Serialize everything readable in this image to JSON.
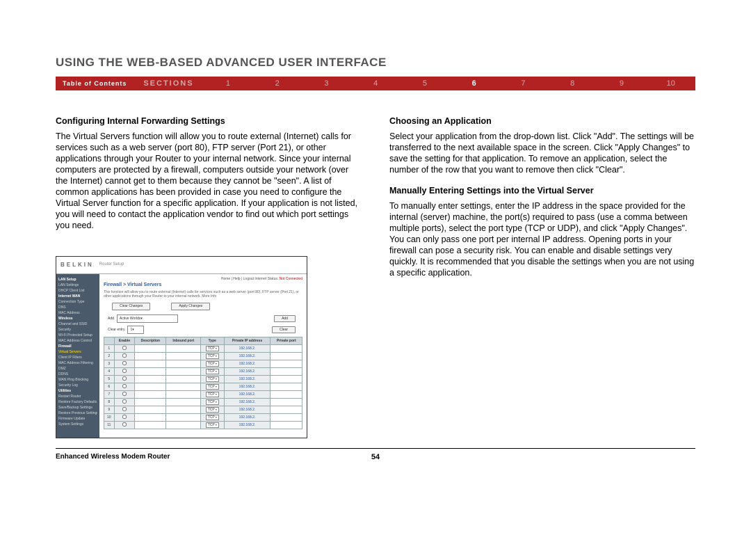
{
  "title": "USING THE WEB-BASED ADVANCED USER INTERFACE",
  "nav": {
    "toc": "Table of Contents",
    "sections_label": "SECTIONS",
    "items": [
      "1",
      "2",
      "3",
      "4",
      "5",
      "6",
      "7",
      "8",
      "9",
      "10"
    ],
    "active": "6"
  },
  "left": {
    "h1": "Configuring Internal Forwarding Settings",
    "p1": "The Virtual Servers function will allow you to route external (Internet) calls for services such as a web server (port 80), FTP server (Port 21), or other applications through your Router to your internal network. Since your internal computers are protected by a firewall, computers outside your network (over the Internet) cannot get to them because they cannot be \"seen\". A list of common applications has been provided in case you need to configure the Virtual Server function for a specific application. If your application is not listed, you will need to contact the application vendor to find out which port settings you need."
  },
  "right": {
    "h1": "Choosing an Application",
    "p1": "Select your application from the drop-down list. Click \"Add\". The settings will be transferred to the next available space in the screen. Click \"Apply Changes\" to save the setting for that application. To remove an application, select the number of the row that you want to remove then click \"Clear\".",
    "h2": "Manually Entering Settings into the Virtual Server",
    "p2": "To manually enter settings, enter the IP address in the space provided for the internal (server) machine, the port(s) required to pass (use a comma between multiple ports), select the port type (TCP or UDP), and click \"Apply Changes\". You can only pass one port per internal IP address. Opening ports in your firewall can pose a security risk. You can enable and disable settings very quickly. It is recommended that you disable the settings when you are not using a specific application."
  },
  "shot": {
    "brand": "BELKIN",
    "brand_sub": "Router Setup",
    "top_links": "Home | Help | Logout   Internet Status:",
    "top_status": "Not Connected",
    "breadcrumb": "Firewall > Virtual Servers",
    "desc": "This function will allow you to route external (Internet) calls for services such as a web server (port 80), FTP server (Port 21), or other applications through your Router to your internal network. More Info",
    "clear_changes": "Clear Changes",
    "apply_changes": "Apply Changes",
    "add_label": "Add",
    "add_select": "Active Worlds",
    "add_btn": "Add",
    "clear_label": "Clear entry",
    "clear_select": "1",
    "clear_btn": "Clear",
    "headers": [
      "",
      "Enable",
      "Description",
      "Inbound port",
      "Type",
      "Private IP address",
      "Private port"
    ],
    "type_val": "TCP",
    "ip_prefix": "192.168.2.",
    "rows": [
      "1",
      "2",
      "3",
      "4",
      "5",
      "6",
      "7",
      "8",
      "9",
      "10",
      "11"
    ],
    "sidebar": [
      {
        "t": "LAN Setup",
        "c": "cat"
      },
      {
        "t": "LAN Settings"
      },
      {
        "t": "DHCP Client List"
      },
      {
        "t": "Internet WAN",
        "c": "cat"
      },
      {
        "t": "Connection Type"
      },
      {
        "t": "DNS"
      },
      {
        "t": "MAC Address"
      },
      {
        "t": "Wireless",
        "c": "cat"
      },
      {
        "t": "Channel and SSID"
      },
      {
        "t": "Security"
      },
      {
        "t": "Wi-Fi Protected Setup"
      },
      {
        "t": "MAC Address Control"
      },
      {
        "t": "Firewall",
        "c": "cat"
      },
      {
        "t": "Virtual Servers",
        "c": "active"
      },
      {
        "t": "Client IP Filters"
      },
      {
        "t": "MAC Address Filtering"
      },
      {
        "t": "DMZ"
      },
      {
        "t": "DDNS"
      },
      {
        "t": "WAN Ping Blocking"
      },
      {
        "t": "Security Log"
      },
      {
        "t": "Utilities",
        "c": "cat"
      },
      {
        "t": "Restart Router"
      },
      {
        "t": "Restore Factory Defaults"
      },
      {
        "t": "Save/Backup Settings"
      },
      {
        "t": "Restore Previous Settings"
      },
      {
        "t": "Firmware Update"
      },
      {
        "t": "System Settings"
      }
    ]
  },
  "footer": {
    "product": "Enhanced Wireless Modem Router",
    "page": "54"
  }
}
